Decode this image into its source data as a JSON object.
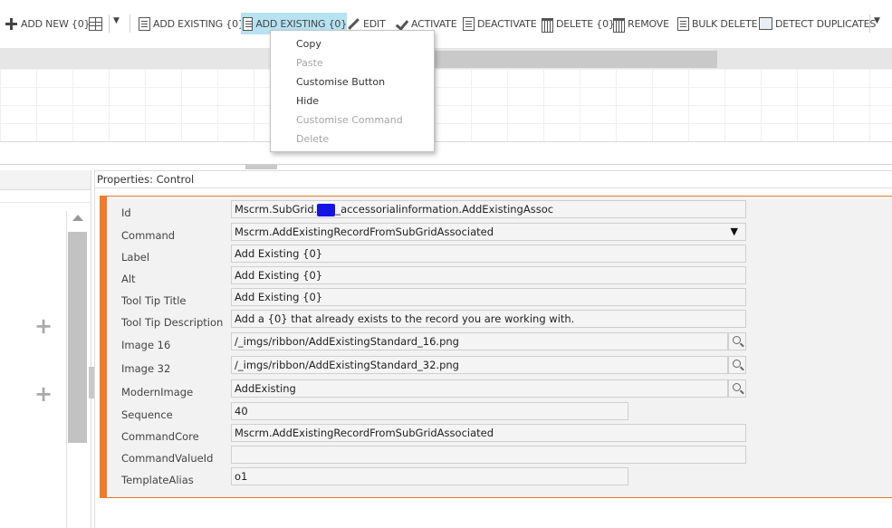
{
  "ribbon": {
    "add_new": "ADD NEW {0}",
    "add_existing_1": "ADD EXISTING {0}",
    "add_existing_2": "ADD EXISTING {0}",
    "edit": "EDIT",
    "activate": "ACTIVATE",
    "deactivate": "DEACTIVATE",
    "delete": "DELETE {0}",
    "remove": "REMOVE",
    "bulk_delete": "BULK DELETE",
    "detect_duplicates": "DETECT DUPLICATES",
    "dropdown_glyph": "▼"
  },
  "context_menu": {
    "items": [
      {
        "label": "Copy",
        "enabled": true
      },
      {
        "label": "Paste",
        "enabled": false
      },
      {
        "label": "Customise Button",
        "enabled": true
      },
      {
        "label": "Hide",
        "enabled": true
      },
      {
        "label": "Customise Command",
        "enabled": false
      },
      {
        "label": "Delete",
        "enabled": false
      }
    ]
  },
  "left_panel": {
    "plus_glyph": "+"
  },
  "properties": {
    "title": "Properties: Control",
    "id_label": "Id",
    "id_prefix": "Mscrm.SubGrid.",
    "id_suffix": "_accessorialinformation.AddExistingAssoc",
    "command_label": "Command",
    "command_value": "Mscrm.AddExistingRecordFromSubGridAssociated",
    "label_label": "Label",
    "label_value": "Add Existing {0}",
    "alt_label": "Alt",
    "alt_value": "Add Existing {0}",
    "tooltip_title_label": "Tool Tip Title",
    "tooltip_title_value": "Add Existing {0}",
    "tooltip_desc_label": "Tool Tip Description",
    "tooltip_desc_value": "Add a {0} that already exists to the record you are working with.",
    "image16_label": "Image 16",
    "image16_value": "/_imgs/ribbon/AddExistingStandard_16.png",
    "image32_label": "Image 32",
    "image32_value": "/_imgs/ribbon/AddExistingStandard_32.png",
    "modern_image_label": "ModernImage",
    "modern_image_value": "AddExisting",
    "sequence_label": "Sequence",
    "sequence_value": "40",
    "command_core_label": "CommandCore",
    "command_core_value": "Mscrm.AddExistingRecordFromSubGridAssociated",
    "command_value_id_label": "CommandValueId",
    "command_value_id_value": "",
    "template_alias_label": "TemplateAlias",
    "template_alias_value": "o1"
  },
  "colors": {
    "accent_orange": "#f07c2b",
    "highlight_blue": "#b6e2f2",
    "redaction": "#1414e6"
  }
}
